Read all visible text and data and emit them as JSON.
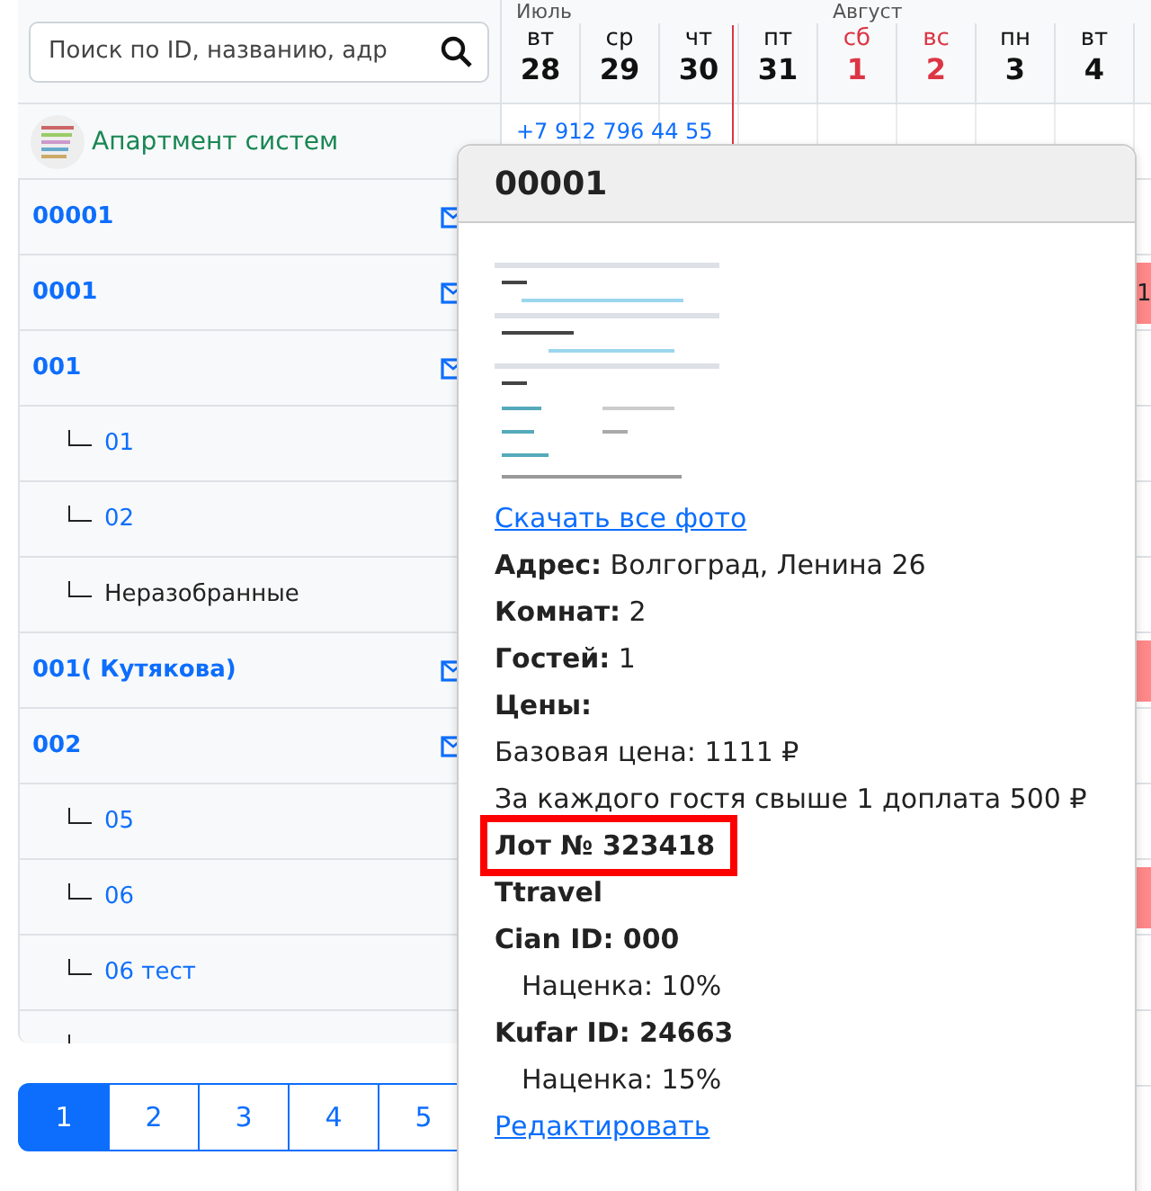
{
  "search": {
    "placeholder": "Поиск по ID, названию, адр"
  },
  "company": {
    "name": "Апартмент систем",
    "phone": "+7 912 796 44 55"
  },
  "calendar": {
    "months": [
      {
        "label": "Июль"
      },
      {
        "label": "Август"
      }
    ],
    "days": [
      {
        "weekday": "вт",
        "date": "28",
        "weekend": false,
        "today": false
      },
      {
        "weekday": "ср",
        "date": "29",
        "weekend": false,
        "today": false
      },
      {
        "weekday": "чт",
        "date": "30",
        "weekend": false,
        "today": false
      },
      {
        "weekday": "пт",
        "date": "31",
        "weekend": false,
        "today": true
      },
      {
        "weekday": "сб",
        "date": "1",
        "weekend": true,
        "today": false
      },
      {
        "weekday": "вс",
        "date": "2",
        "weekend": true,
        "today": false
      },
      {
        "weekday": "пн",
        "date": "3",
        "weekend": false,
        "today": false
      },
      {
        "weekday": "вт",
        "date": "4",
        "weekend": false,
        "today": false
      }
    ],
    "bookings": [
      {
        "kind": "booking",
        "label": "1"
      },
      {
        "kind": "booking"
      },
      {
        "kind": "booking"
      }
    ]
  },
  "properties": [
    {
      "name": "00001",
      "mail": true
    },
    {
      "name": "0001",
      "mail": true
    },
    {
      "name": "001",
      "mail": true,
      "children": [
        {
          "name": "01",
          "kind": "link"
        },
        {
          "name": "02",
          "kind": "link"
        },
        {
          "name": "Неразобранные",
          "kind": "plain"
        }
      ]
    },
    {
      "name": "001( Кутякова)",
      "mail": true
    },
    {
      "name": "002",
      "mail": true,
      "children": [
        {
          "name": "05",
          "kind": "link"
        },
        {
          "name": "06",
          "kind": "link"
        },
        {
          "name": "06 тест",
          "kind": "link"
        }
      ]
    }
  ],
  "pagination": [
    {
      "label": "1",
      "selected": true
    },
    {
      "label": "2",
      "selected": false
    },
    {
      "label": "3",
      "selected": false
    },
    {
      "label": "4",
      "selected": false
    },
    {
      "label": "5",
      "selected": false
    }
  ],
  "popover": {
    "title": "00001",
    "lines": [
      {
        "kind": "link",
        "text": "Скачать все фото"
      },
      {
        "kind": "text",
        "text": "**Адрес:** Волгоград, Ленина 26"
      },
      {
        "kind": "text",
        "text": "**Комнат:** 2"
      },
      {
        "kind": "text",
        "text": "**Гостей:** 1"
      },
      {
        "kind": "heading",
        "text": "Цены:"
      },
      {
        "kind": "text",
        "text": "Базовая цена: 1111 ₽"
      },
      {
        "kind": "text",
        "text": "За каждого гостя свыше 1 доплата 500 ₽"
      },
      {
        "kind": "heading",
        "text": "Лот № 323418",
        "highlighted": true
      },
      {
        "kind": "heading",
        "text": "Ttravel"
      },
      {
        "kind": "heading",
        "text": "Cian ID: 000"
      },
      {
        "kind": "indent",
        "text": "Наценка: 10%"
      },
      {
        "kind": "heading",
        "text": "Kufar ID: 24663"
      },
      {
        "kind": "indent",
        "text": "Наценка: 15%"
      },
      {
        "kind": "link",
        "text": "Редактировать"
      }
    ]
  }
}
